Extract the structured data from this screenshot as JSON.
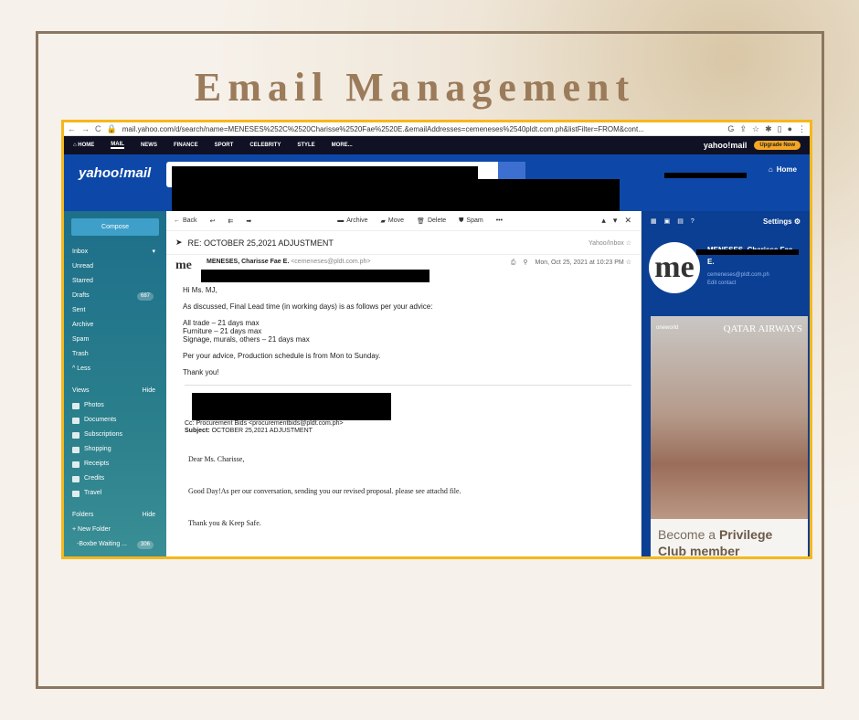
{
  "page": {
    "title": "Email Management"
  },
  "browser": {
    "url": "mail.yahoo.com/d/search/name=MENESES%252C%2520Charisse%2520Fae%2520E.&emailAddresses=cemeneses%2540pldt.com.ph&listFilter=FROM&cont...",
    "nav_back": "←",
    "nav_forward": "→",
    "reload": "C"
  },
  "topnav": {
    "items": [
      "HOME",
      "MAIL",
      "NEWS",
      "FINANCE",
      "SPORT",
      "CELEBRITY",
      "STYLE",
      "MORE..."
    ],
    "brand": "yahoo!mail",
    "upgrade": "Upgrade Now"
  },
  "header": {
    "logo": "yahoo!mail",
    "home": "Home"
  },
  "sidebar": {
    "compose": "Compose",
    "inbox": "Inbox",
    "items": [
      "Unread",
      "Starred",
      "Drafts",
      "Sent",
      "Archive",
      "Spam",
      "Trash",
      "^ Less"
    ],
    "drafts_count": "687",
    "views_label": "Views",
    "views_hide": "Hide",
    "views": [
      "Photos",
      "Documents",
      "Subscriptions",
      "Shopping",
      "Receipts",
      "Credits",
      "Travel"
    ],
    "folders_label": "Folders",
    "folders_hide": "Hide",
    "new_folder": "+ New Folder",
    "folder_item": "-Boxbe Waiting ...",
    "folder_count": "306"
  },
  "toolbar": {
    "back": "Back",
    "archive": "Archive",
    "move": "Move",
    "delete": "Delete",
    "spam": "Spam",
    "more": "•••"
  },
  "message": {
    "subject": "RE: OCTOBER 25,2021 ADJUSTMENT",
    "folder": "Yahoo/Inbox",
    "sender_name": "MENESES, Charisse Fae E.",
    "sender_email": "<cemeneses@pldt.com.ph>",
    "date": "Mon, Oct 25, 2021 at 10:23 PM",
    "greeting": "Hi Ms. MJ,",
    "intro": "As discussed, Final Lead time (in working days) is as follows per your advice:",
    "lines": [
      "All trade – 21 days max",
      "Furniture – 21 days max",
      "Signage, murals, others – 21 days max"
    ],
    "schedule": "Per your advice, Production schedule is from Mon to Sunday.",
    "thanks": "Thank you!",
    "quote_cc": "Cc: Procurement Bids <procurementbids@pldt.com.ph>",
    "quote_subject_label": "Subject:",
    "quote_subject": "OCTOBER 25,2021 ADJUSTMENT",
    "reply_greeting": "Dear Ms. Charisse,",
    "reply_body": "Good Day!As per our conversation, sending you our revised proposal. please see attachd file.",
    "reply_close": "Thank you & Keep Safe."
  },
  "rightpanel": {
    "settings": "Settings",
    "contact_name": "MENESES, Charisse Fae E.",
    "contact_email": "cemeneses@pldt.com.ph",
    "edit_contact": "Edit contact",
    "avatar": "me",
    "ad_brand": "oneworld",
    "ad_airline": "QATAR AIRWAYS",
    "ad_text_1": "Become a",
    "ad_text_2": "Privilege",
    "ad_text_3": "Club member"
  },
  "colors": {
    "accent_gold": "#f5b71b",
    "yahoo_blue": "#0d48a8",
    "title_brown": "#9b7b5a"
  }
}
